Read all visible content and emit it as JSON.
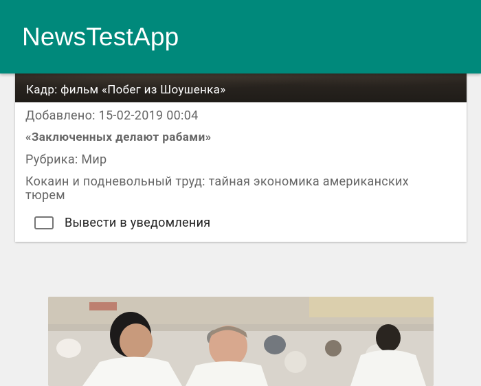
{
  "app": {
    "title": "NewsTestApp",
    "primary_color": "#00897b"
  },
  "news_card": {
    "image_caption": "Кадр: фильм «Побег из Шоушенка»",
    "added": "Добавлено: 15-02-2019 00:04",
    "headline": "«Заключенных делают рабами»",
    "rubric": "Рубрика: Мир",
    "description": "Кокаин и подневольный труд: тайная экономика американских тюрем",
    "notify_label": "Вывести в уведомления",
    "notify_checked": false
  },
  "next_card": {
    "image": "photo-two-men-in-white-kimonos"
  }
}
